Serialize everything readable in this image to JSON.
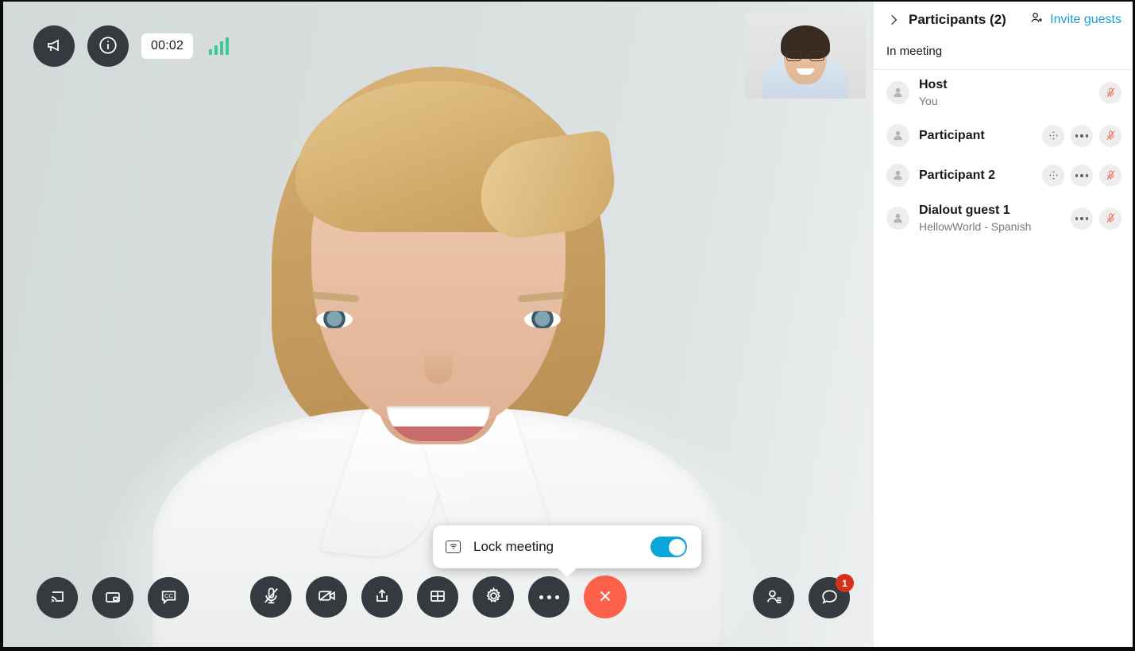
{
  "meeting": {
    "timer": "00:02",
    "announce_icon": "megaphone-icon",
    "info_icon": "info-icon",
    "signal_icon": "signal-strength-icon",
    "signal_color": "#3dc997",
    "self_view_label": "self-view"
  },
  "popover": {
    "icon": "lock-meeting-icon",
    "label": "Lock meeting",
    "toggle_state": "on",
    "toggle_color": "#0ba5d8"
  },
  "toolbar": {
    "left": [
      {
        "name": "cast-screen-button",
        "icon": "cast-icon"
      },
      {
        "name": "picture-in-picture-button",
        "icon": "pip-icon"
      },
      {
        "name": "closed-captions-button",
        "icon": "cc-icon",
        "label": "CC"
      }
    ],
    "center": [
      {
        "name": "microphone-mute-button",
        "icon": "mic-muted-icon"
      },
      {
        "name": "camera-off-button",
        "icon": "camera-off-icon"
      },
      {
        "name": "share-content-button",
        "icon": "share-upload-icon"
      },
      {
        "name": "layout-button",
        "icon": "grid-layout-icon"
      },
      {
        "name": "settings-button",
        "icon": "gear-icon"
      },
      {
        "name": "more-options-button",
        "icon": "ellipsis-icon"
      },
      {
        "name": "end-call-button",
        "icon": "close-x-icon",
        "color": "#fc6149"
      }
    ],
    "right": [
      {
        "name": "participants-button",
        "icon": "participants-icon"
      },
      {
        "name": "chat-button",
        "icon": "chat-bubble-icon",
        "badge": "1",
        "badge_color": "#d5311e"
      }
    ]
  },
  "panel": {
    "collapse_icon": "chevron-right-icon",
    "title": "Participants (2)",
    "invite_icon": "add-person-icon",
    "invite_label": "Invite guests",
    "invite_color": "#1a9fd4",
    "section_label": "In meeting",
    "participants": [
      {
        "name": "Host",
        "subtitle": "You",
        "actions": [
          "mute"
        ]
      },
      {
        "name": "Participant",
        "subtitle": "",
        "actions": [
          "camera-control",
          "more",
          "mute"
        ]
      },
      {
        "name": "Participant 2",
        "subtitle": "",
        "actions": [
          "camera-control",
          "more",
          "mute"
        ]
      },
      {
        "name": "Dialout guest 1",
        "subtitle": "HellowWorld - Spanish",
        "actions": [
          "more",
          "mute"
        ]
      }
    ]
  }
}
